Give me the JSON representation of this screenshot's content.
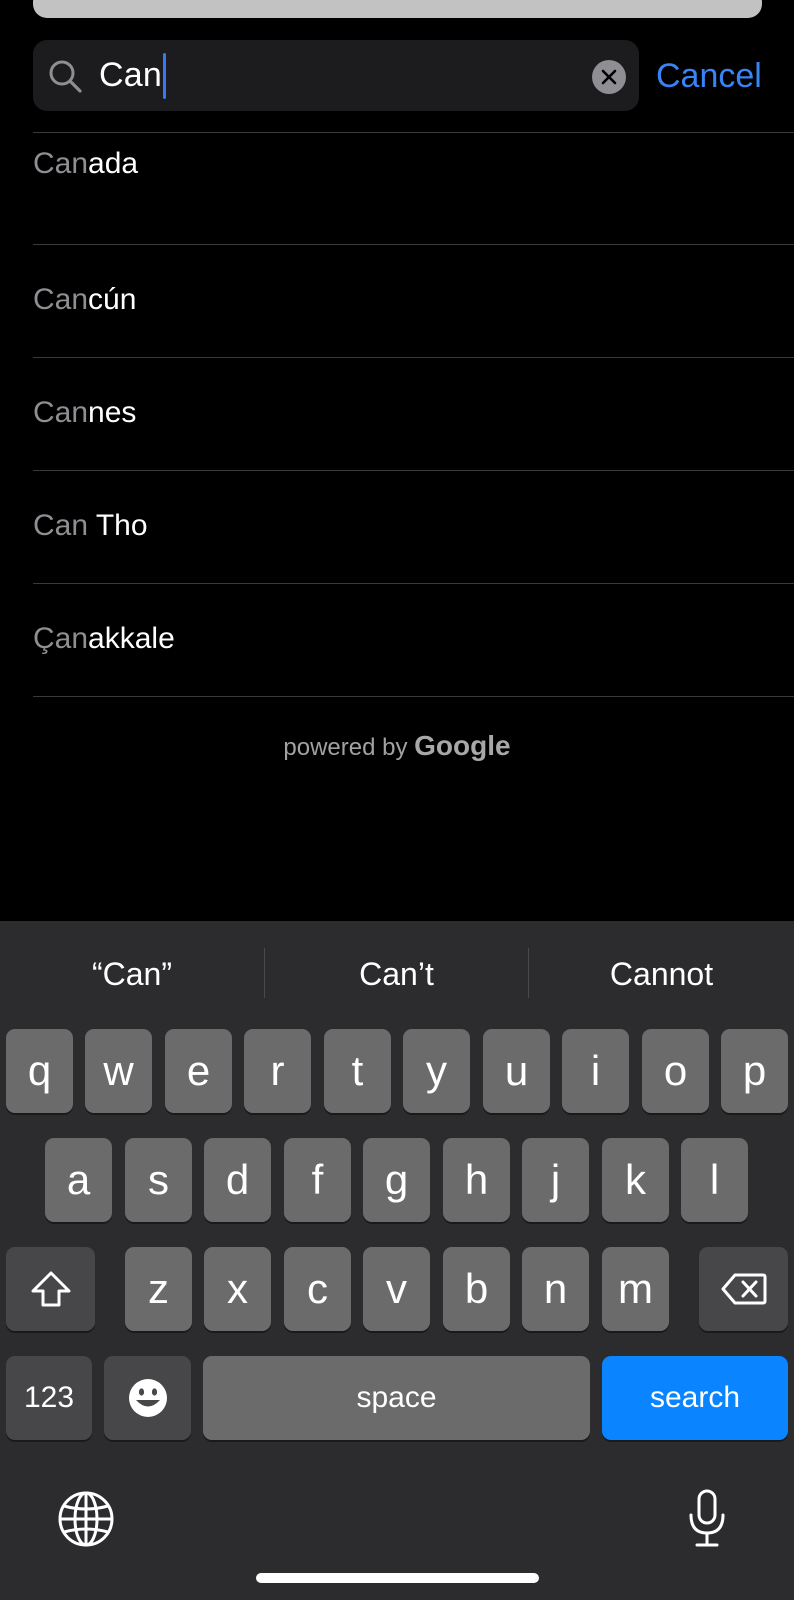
{
  "search": {
    "value": "Can",
    "cancel_label": "Cancel"
  },
  "results": [
    {
      "match": "Can",
      "rest": "ada"
    },
    {
      "match": "Can",
      "rest": "cún"
    },
    {
      "match": "Can",
      "rest": "nes"
    },
    {
      "match": "Can",
      "rest": " Tho"
    },
    {
      "match": "Çan",
      "rest": "akkale"
    }
  ],
  "attribution": {
    "prefix": "powered by",
    "brand": "Google"
  },
  "suggestions": [
    "“Can”",
    "Can’t",
    "Cannot"
  ],
  "keyboard": {
    "row1": [
      "q",
      "w",
      "e",
      "r",
      "t",
      "y",
      "u",
      "i",
      "o",
      "p"
    ],
    "row2": [
      "a",
      "s",
      "d",
      "f",
      "g",
      "h",
      "j",
      "k",
      "l"
    ],
    "row3": [
      "z",
      "x",
      "c",
      "v",
      "b",
      "n",
      "m"
    ],
    "numbers_label": "123",
    "space_label": "space",
    "search_label": "search"
  },
  "icons": {
    "search": "magnifier",
    "clear": "x-circle",
    "shift": "shift-arrow",
    "backspace": "delete-left",
    "emoji": "smiley",
    "globe": "globe",
    "mic": "microphone"
  },
  "colors": {
    "accent": "#0a84ff",
    "cancel": "#3884f7",
    "background": "#000000",
    "keyboard": "#2c2c2e"
  }
}
